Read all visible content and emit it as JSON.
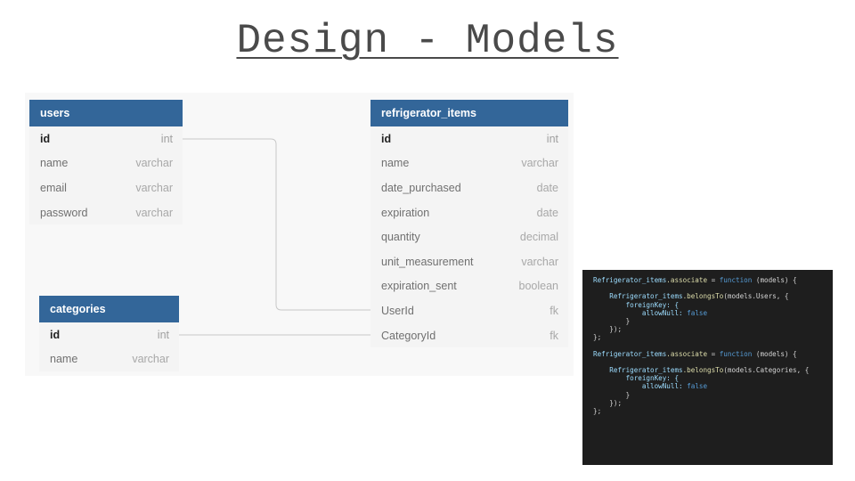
{
  "title": "Design - Models",
  "tables": {
    "users": {
      "name": "users",
      "fields": [
        {
          "name": "id",
          "type": "int"
        },
        {
          "name": "name",
          "type": "varchar"
        },
        {
          "name": "email",
          "type": "varchar"
        },
        {
          "name": "password",
          "type": "varchar"
        }
      ]
    },
    "refrigerator_items": {
      "name": "refrigerator_items",
      "fields": [
        {
          "name": "id",
          "type": "int"
        },
        {
          "name": "name",
          "type": "varchar"
        },
        {
          "name": "date_purchased",
          "type": "date"
        },
        {
          "name": "expiration",
          "type": "date"
        },
        {
          "name": "quantity",
          "type": "decimal"
        },
        {
          "name": "unit_measurement",
          "type": "varchar"
        },
        {
          "name": "expiration_sent",
          "type": "boolean"
        },
        {
          "name": "UserId",
          "type": "fk"
        },
        {
          "name": "CategoryId",
          "type": "fk"
        }
      ]
    },
    "categories": {
      "name": "categories",
      "fields": [
        {
          "name": "id",
          "type": "int"
        },
        {
          "name": "name",
          "type": "varchar"
        }
      ]
    }
  },
  "code": {
    "blocks": [
      {
        "assoc_obj": "Refrigerator_items",
        "assoc_method": ".associate",
        "assoc_eq": " = ",
        "kw_function": "function",
        "params": " (models) {",
        "belongs_obj": "Refrigerator_items",
        "belongs_method": ".belongsTo",
        "belongs_args": "(models.Users, {",
        "fk_key": "foreignKey: {",
        "allow_key": "allowNull: ",
        "allow_val": "false",
        "close_inner": "}",
        "close_call": "});",
        "close_fn": "};"
      },
      {
        "assoc_obj": "Refrigerator_items",
        "assoc_method": ".associate",
        "assoc_eq": " = ",
        "kw_function": "function",
        "params": " (models) {",
        "belongs_obj": "Refrigerator_items",
        "belongs_method": ".belongsTo",
        "belongs_args": "(models.Categories, {",
        "fk_key": "foreignKey: {",
        "allow_key": "allowNull: ",
        "allow_val": "false",
        "close_inner": "}",
        "close_call": "});",
        "close_fn": "};"
      }
    ]
  }
}
